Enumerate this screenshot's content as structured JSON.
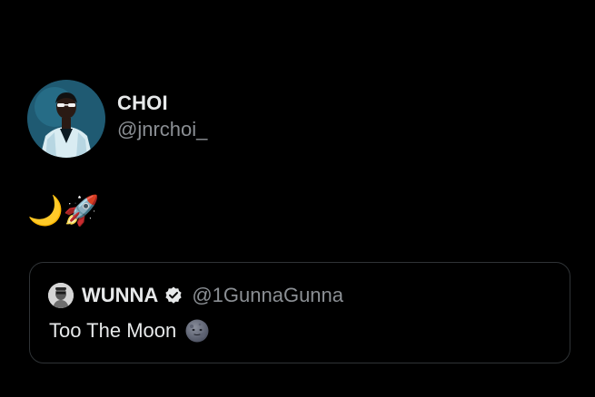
{
  "tweet": {
    "author": {
      "display_name": "CHOI",
      "handle": "@jnrchoi_"
    },
    "text": "🌙🚀",
    "quoted": {
      "display_name": "WUNNA",
      "verified": true,
      "handle": "@1GunnaGunna",
      "text": "Too The Moon"
    }
  },
  "colors": {
    "background": "#000000",
    "primary_text": "#e7e9ea",
    "secondary_text": "#8b8f94",
    "border": "#2f3336"
  },
  "icons": {
    "verified": "verified-badge-icon",
    "moon_face": "new-moon-face-icon"
  }
}
